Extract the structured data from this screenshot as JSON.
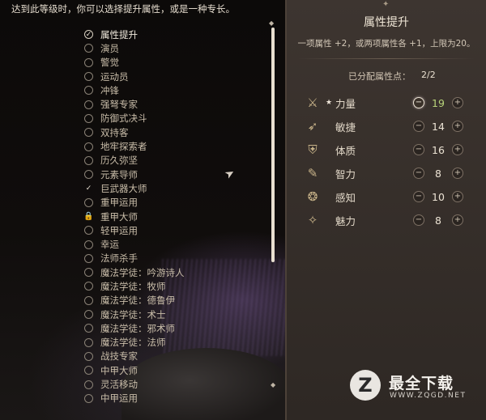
{
  "hint": "达到此等级时，你可以选择提升属性，或是一种专长。",
  "feats": [
    {
      "label": "属性提升",
      "state": "checked"
    },
    {
      "label": "演员",
      "state": "empty"
    },
    {
      "label": "警觉",
      "state": "empty"
    },
    {
      "label": "运动员",
      "state": "empty"
    },
    {
      "label": "冲锋",
      "state": "empty"
    },
    {
      "label": "强弩专家",
      "state": "empty"
    },
    {
      "label": "防御式决斗",
      "state": "empty"
    },
    {
      "label": "双持客",
      "state": "empty"
    },
    {
      "label": "地牢探索者",
      "state": "empty"
    },
    {
      "label": "历久弥坚",
      "state": "empty"
    },
    {
      "label": "元素导师",
      "state": "empty"
    },
    {
      "label": "巨武器大师",
      "state": "tick"
    },
    {
      "label": "重甲运用",
      "state": "empty"
    },
    {
      "label": "重甲大师",
      "state": "locked"
    },
    {
      "label": "轻甲运用",
      "state": "empty"
    },
    {
      "label": "幸运",
      "state": "empty"
    },
    {
      "label": "法师杀手",
      "state": "empty"
    },
    {
      "label": "魔法学徒：吟游诗人",
      "state": "empty"
    },
    {
      "label": "魔法学徒：牧师",
      "state": "empty"
    },
    {
      "label": "魔法学徒：德鲁伊",
      "state": "empty"
    },
    {
      "label": "魔法学徒：术士",
      "state": "empty"
    },
    {
      "label": "魔法学徒：邪术师",
      "state": "empty"
    },
    {
      "label": "魔法学徒：法师",
      "state": "empty"
    },
    {
      "label": "战技专家",
      "state": "empty"
    },
    {
      "label": "中甲大师",
      "state": "empty"
    },
    {
      "label": "灵活移动",
      "state": "empty"
    },
    {
      "label": "中甲运用",
      "state": "empty"
    }
  ],
  "panel": {
    "title": "属性提升",
    "description": "一项属性 +2，或两项属性各 +1，上限为20。",
    "points_label": "已分配属性点：",
    "points_value": "2/2"
  },
  "attributes": [
    {
      "name": "力量",
      "value": "19",
      "icon": "sword-icon",
      "glyph": "⚔",
      "starred": true,
      "boosted": true
    },
    {
      "name": "敏捷",
      "value": "14",
      "icon": "feather-icon",
      "glyph": "➶",
      "starred": false,
      "boosted": false
    },
    {
      "name": "体质",
      "value": "16",
      "icon": "shield-icon",
      "glyph": "⛨",
      "starred": false,
      "boosted": false
    },
    {
      "name": "智力",
      "value": "8",
      "icon": "scroll-icon",
      "glyph": "✎",
      "starred": false,
      "boosted": false
    },
    {
      "name": "感知",
      "value": "10",
      "icon": "eye-icon",
      "glyph": "❂",
      "starred": false,
      "boosted": false
    },
    {
      "name": "魅力",
      "value": "8",
      "icon": "mask-icon",
      "glyph": "✧",
      "starred": false,
      "boosted": false
    }
  ],
  "watermark": {
    "title": "最全下载",
    "url": "WWW.ZQGD.NET"
  },
  "colors": {
    "panel_bg": "#3d3530",
    "boosted_value": "#b8d47a",
    "text": "#d8cfc0"
  }
}
